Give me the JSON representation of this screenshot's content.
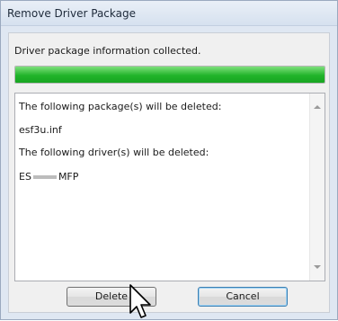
{
  "window": {
    "title": "Remove Driver Package"
  },
  "status": {
    "message": "Driver package information collected.",
    "progress_percent": 100,
    "progress_color": "#21b42a"
  },
  "details": {
    "package_header": "The following package(s) will be deleted:",
    "package_name": "esf3u.inf",
    "driver_header": "The following driver(s) will be deleted:",
    "driver_name_prefix": "ES",
    "driver_name_suffix": "MFP"
  },
  "buttons": {
    "delete_label": "Delete",
    "cancel_label": "Cancel"
  },
  "icons": {
    "cursor": "arrow-cursor-icon",
    "scroll_up": "scroll-up-arrow-icon",
    "scroll_down": "scroll-down-arrow-icon"
  }
}
